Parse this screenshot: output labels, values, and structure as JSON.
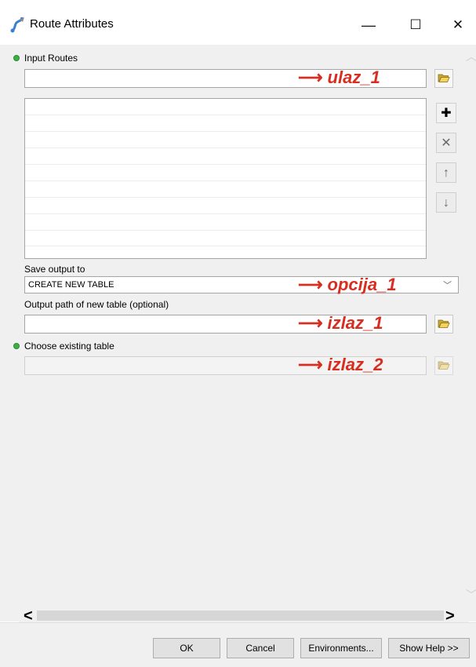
{
  "window": {
    "title": "Route Attributes",
    "minimize": "—",
    "maximize": "☐",
    "close": "✕"
  },
  "fields": {
    "input_routes_label": "Input Routes",
    "save_output_label": "Save output to",
    "save_output_value": "CREATE NEW TABLE",
    "output_path_label": "Output path of new table (optional)",
    "existing_table_label": "Choose existing table"
  },
  "list_buttons": {
    "add": "✚",
    "remove": "✕",
    "up": "🡅",
    "down": "🡇"
  },
  "annotations": {
    "arrow": "⟶",
    "ulaz_1": "ulaz_1",
    "opcija_1": "opcija_1",
    "izlaz_1": "izlaz_1",
    "izlaz_2": "izlaz_2",
    "color": "#d62f21"
  },
  "scroll": {
    "left": "<",
    "right": ">"
  },
  "footer": {
    "ok": "OK",
    "cancel": "Cancel",
    "environments": "Environments...",
    "show_help": "Show Help >>"
  }
}
